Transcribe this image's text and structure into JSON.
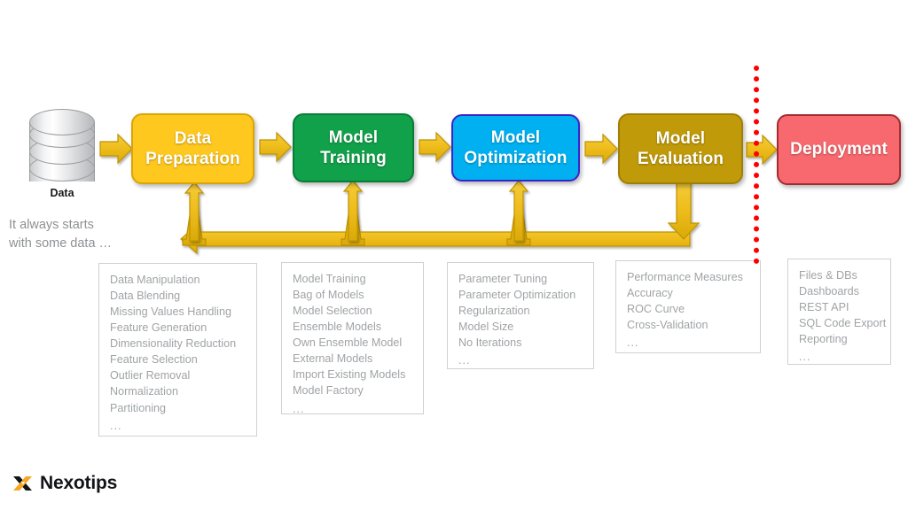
{
  "source": {
    "icon": "database-cylinder-icon",
    "label": "Data",
    "note_line1": "It always starts",
    "note_line2": "with some data …"
  },
  "pipeline": {
    "stages": [
      {
        "id": "data-preparation",
        "line1": "Data",
        "line2": "Preparation",
        "fill": "#FFC81E",
        "border": "#D9A406",
        "details": [
          "Data Manipulation",
          "Data Blending",
          "Missing Values Handling",
          "Feature Generation",
          "Dimensionality Reduction",
          "Feature Selection",
          "Outlier Removal",
          "Normalization",
          "Partitioning",
          "..."
        ]
      },
      {
        "id": "model-training",
        "line1": "Model",
        "line2": "Training",
        "fill": "#11A14A",
        "border": "#0A7C37",
        "details": [
          "Model Training",
          "Bag of Models",
          "Model Selection",
          "Ensemble Models",
          "Own Ensemble Model",
          "External Models",
          "Import Existing Models",
          "Model Factory",
          "..."
        ]
      },
      {
        "id": "model-optimization",
        "line1": "Model",
        "line2": "Optimization",
        "fill": "#00B0F0",
        "border": "#3A24C8",
        "details": [
          "Parameter Tuning",
          "Parameter Optimization",
          "Regularization",
          "Model Size",
          "No Iterations",
          "..."
        ]
      },
      {
        "id": "model-evaluation",
        "line1": "Model",
        "line2": "Evaluation",
        "fill": "#C09A09",
        "border": "#A07F06",
        "details": [
          "Performance Measures",
          "Accuracy",
          "ROC Curve",
          "Cross-Validation",
          "..."
        ]
      },
      {
        "id": "deployment",
        "line1": "Deployment",
        "line2": "",
        "fill": "#F7696E",
        "border": "#A32C31",
        "details": [
          "Files & DBs",
          "Dashboards",
          "REST API",
          "SQL Code Export",
          "Reporting",
          "..."
        ]
      }
    ]
  },
  "colors": {
    "arrow_fill": "#EFBE1E",
    "arrow_stroke": "#BE9206",
    "divider": "#ff0000",
    "list_text": "#a0a3a6",
    "note_text": "#8e9194"
  },
  "divider": {
    "name": "production-boundary"
  },
  "logo": {
    "text": "Nexotips",
    "mark": "x-mark-icon"
  }
}
